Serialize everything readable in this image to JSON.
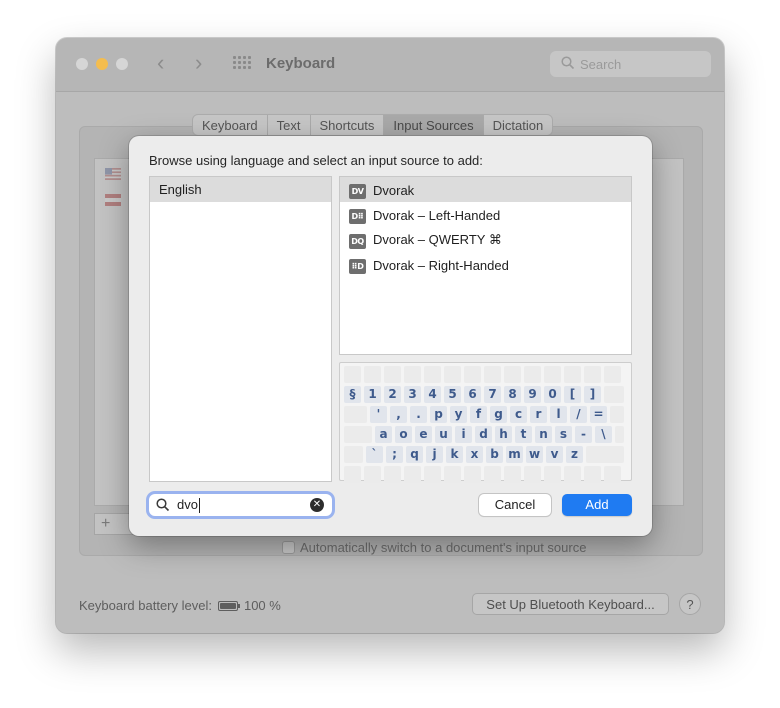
{
  "window": {
    "title": "Keyboard",
    "search_placeholder": "Search",
    "traffic_lights": {
      "close": "#d6d6d6",
      "minimize": "#f4bd4f",
      "zoom": "#d6d6d6"
    }
  },
  "tabs": [
    "Keyboard",
    "Text",
    "Shortcuts",
    "Input Sources",
    "Dictation"
  ],
  "active_tab": "Input Sources",
  "auto_switch_label": "Automatically switch to a document's input source",
  "battery": {
    "label": "Keyboard battery level:",
    "value": "100 %"
  },
  "bluetooth_button": "Set Up Bluetooth Keyboard...",
  "help_label": "?",
  "list_controls": {
    "add": "+"
  },
  "dialog": {
    "prompt": "Browse using language and select an input source to add:",
    "languages": [
      "English"
    ],
    "sources": [
      {
        "badge": "DV",
        "label": "Dvorak",
        "selected": true
      },
      {
        "badge": "D⠿",
        "label": "Dvorak – Left-Handed",
        "selected": false
      },
      {
        "badge": "DQ",
        "label": "Dvorak – QWERTY ⌘",
        "selected": false
      },
      {
        "badge": "⠿D",
        "label": "Dvorak – Right-Handed",
        "selected": false
      }
    ],
    "keyboard_rows": [
      [
        "§",
        "1",
        "2",
        "3",
        "4",
        "5",
        "6",
        "7",
        "8",
        "9",
        "0",
        "[",
        "]"
      ],
      [
        "'",
        ",",
        ".",
        "p",
        "y",
        "f",
        "g",
        "c",
        "r",
        "l",
        "/",
        "="
      ],
      [
        "a",
        "o",
        "e",
        "u",
        "i",
        "d",
        "h",
        "t",
        "n",
        "s",
        "-",
        "\\"
      ],
      [
        "`",
        ";",
        "q",
        "j",
        "k",
        "x",
        "b",
        "m",
        "w",
        "v",
        "z"
      ]
    ],
    "search_value": "dvo",
    "cancel_label": "Cancel",
    "add_label": "Add",
    "accent_color": "#1f7bf2"
  }
}
